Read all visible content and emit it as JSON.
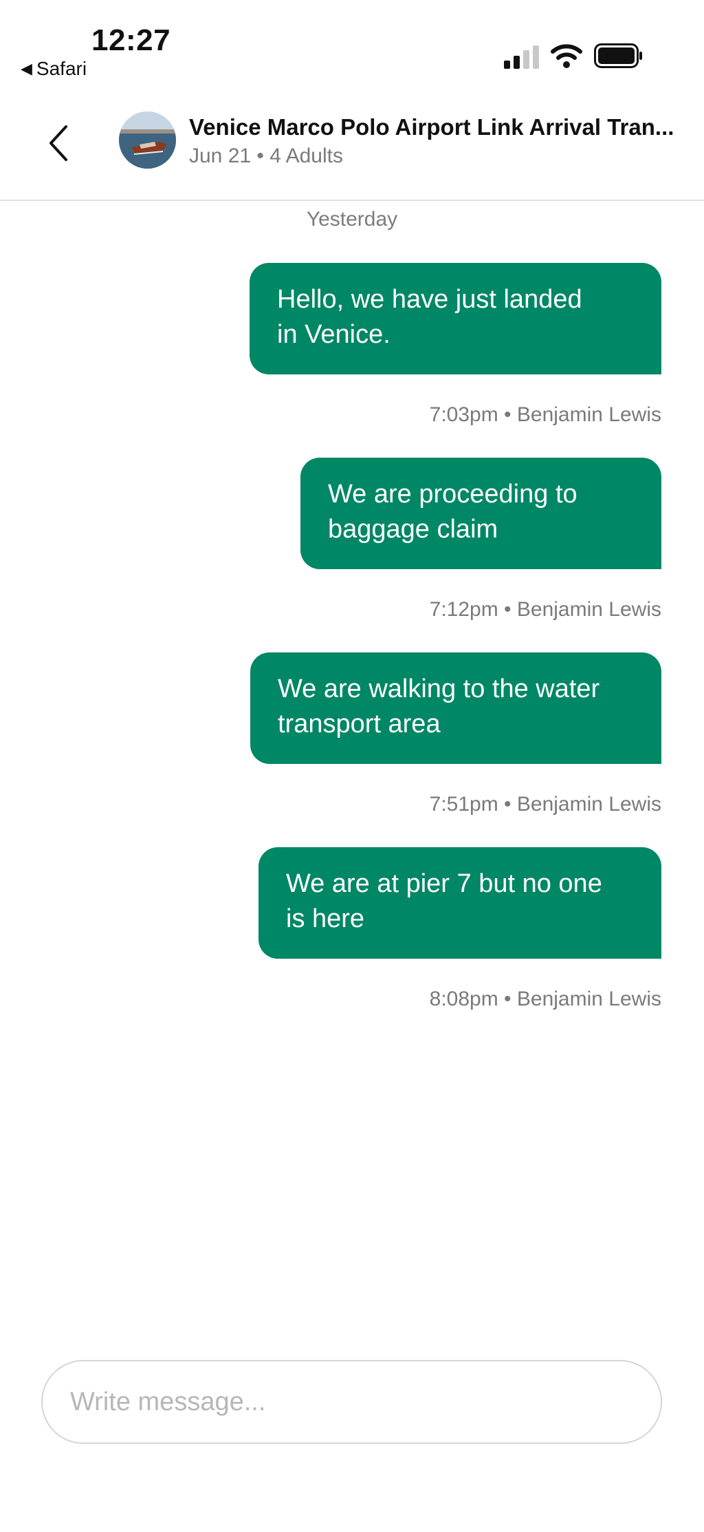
{
  "status_bar": {
    "time": "12:27",
    "back_app": "Safari",
    "back_arrow_glyph": "◀"
  },
  "header": {
    "title": "Venice Marco Polo Airport Link Arrival Tran...",
    "subtitle": "Jun 21 • 4 Adults"
  },
  "conversation": {
    "day_label": "Yesterday",
    "messages": [
      {
        "text_line1": "Hello, we have just landed",
        "text_line2": "in Venice.",
        "meta": "7:03pm • Benjamin Lewis"
      },
      {
        "text_line1": "We are proceeding to",
        "text_line2": "baggage claim",
        "meta": "7:12pm • Benjamin Lewis"
      },
      {
        "text_line1": "We are walking to the water",
        "text_line2": "transport area",
        "meta": "7:51pm • Benjamin Lewis"
      },
      {
        "text_line1": "We are at pier 7 but no one",
        "text_line2": "is here",
        "meta": "8:08pm • Benjamin Lewis"
      }
    ]
  },
  "composer": {
    "placeholder": "Write message...",
    "value": ""
  },
  "colors": {
    "bubble": "#008765",
    "meta_text": "#7a7a7a",
    "divider": "#e3e3e3"
  }
}
